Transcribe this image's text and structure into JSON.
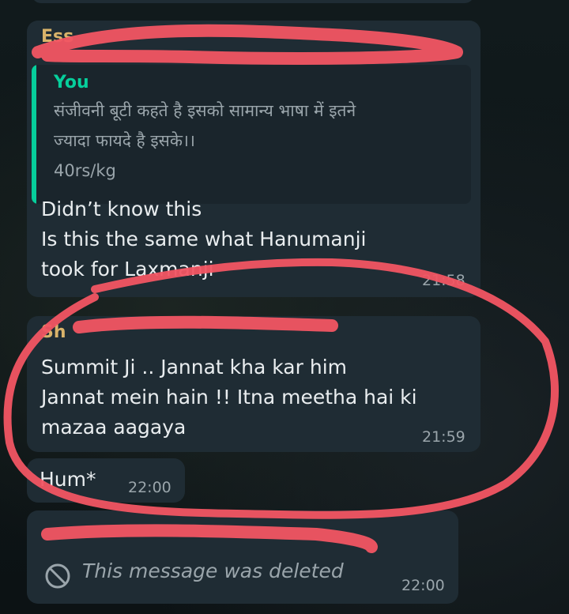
{
  "messages": [
    {
      "sender": "Ess",
      "quote": {
        "author": "You",
        "lines": [
          "संजीवनी बूटी कहते है इसको सामान्य भाषा में इतने",
          "ज्यादा फायदे है इसके।।",
          "40rs/kg"
        ]
      },
      "lines": [
        "Didn’t know this",
        "Is this the same what Hanumanji",
        "took for Laxmanji"
      ],
      "time": "21:58"
    },
    {
      "sender": "Sh",
      "lines": [
        "Summit Ji .. Jannat kha kar him",
        "Jannat mein hain !! Itna meetha hai ki",
        "mazaa aagaya"
      ],
      "time": "21:59"
    },
    {
      "lines": [
        "Hum*"
      ],
      "time": "22:00"
    },
    {
      "deleted_text": "This message was deleted",
      "deleted_icon": "blocked-icon",
      "time": "22:00"
    }
  ],
  "colors": {
    "incoming_bubble": "#1f2c34",
    "quote_accent": "#06cf9c",
    "sender_name": "#d9b36a",
    "annotation": "#f25563"
  }
}
